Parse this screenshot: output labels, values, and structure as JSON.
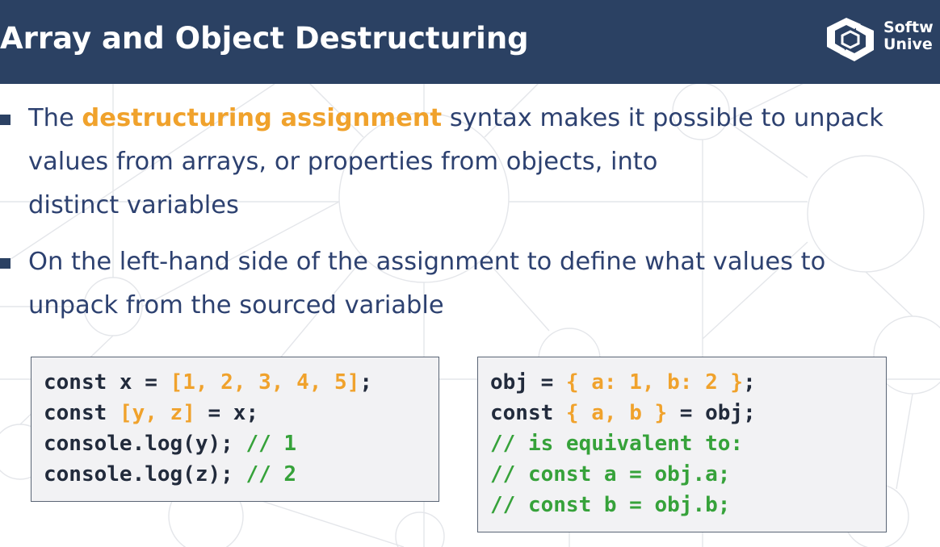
{
  "slide": {
    "title": "Array and Object Destructuring",
    "logo": {
      "icon": "softuni-logo-icon",
      "line1": "Softw",
      "line2": "Unive"
    }
  },
  "bullets": [
    {
      "parts": [
        {
          "text": "The ",
          "style": "normal"
        },
        {
          "text": "destructuring assignment",
          "style": "highlight"
        },
        {
          "text": " syntax makes it possible to unpack",
          "style": "normal"
        }
      ],
      "line2": "values from arrays, or properties from objects, into",
      "line3": "distinct variables"
    },
    {
      "line1": "On the left-hand side of the assignment to define what values to",
      "line2": "unpack from the sourced variable"
    }
  ],
  "code_left": {
    "lines": [
      [
        {
          "t": "const x = ",
          "c": "k"
        },
        {
          "t": "[1, 2, 3, 4, 5]",
          "c": "y"
        },
        {
          "t": ";",
          "c": "k"
        }
      ],
      [
        {
          "t": "const ",
          "c": "k"
        },
        {
          "t": "[y, z]",
          "c": "y"
        },
        {
          "t": " = x;",
          "c": "k"
        }
      ],
      [
        {
          "t": "console.log(y); ",
          "c": "k"
        },
        {
          "t": "// 1",
          "c": "g"
        }
      ],
      [
        {
          "t": "console.log(z); ",
          "c": "k"
        },
        {
          "t": "// 2",
          "c": "g"
        }
      ]
    ]
  },
  "code_right": {
    "lines": [
      [
        {
          "t": "obj = ",
          "c": "k"
        },
        {
          "t": "{ a: 1, b: 2 }",
          "c": "y"
        },
        {
          "t": ";",
          "c": "k"
        }
      ],
      [
        {
          "t": "const ",
          "c": "k"
        },
        {
          "t": "{ a, b }",
          "c": "y"
        },
        {
          "t": " = obj;",
          "c": "k"
        }
      ],
      [
        {
          "t": "// is equivalent to:",
          "c": "g"
        }
      ],
      [
        {
          "t": "// const a = obj.a;",
          "c": "g"
        }
      ],
      [
        {
          "t": "// const b = obj.b;",
          "c": "g"
        }
      ]
    ]
  },
  "colors": {
    "header_bg": "#2b4163",
    "text": "#2d4170",
    "accent": "#f0a22c",
    "comment": "#36a23a",
    "code_bg": "#f2f2f4"
  }
}
